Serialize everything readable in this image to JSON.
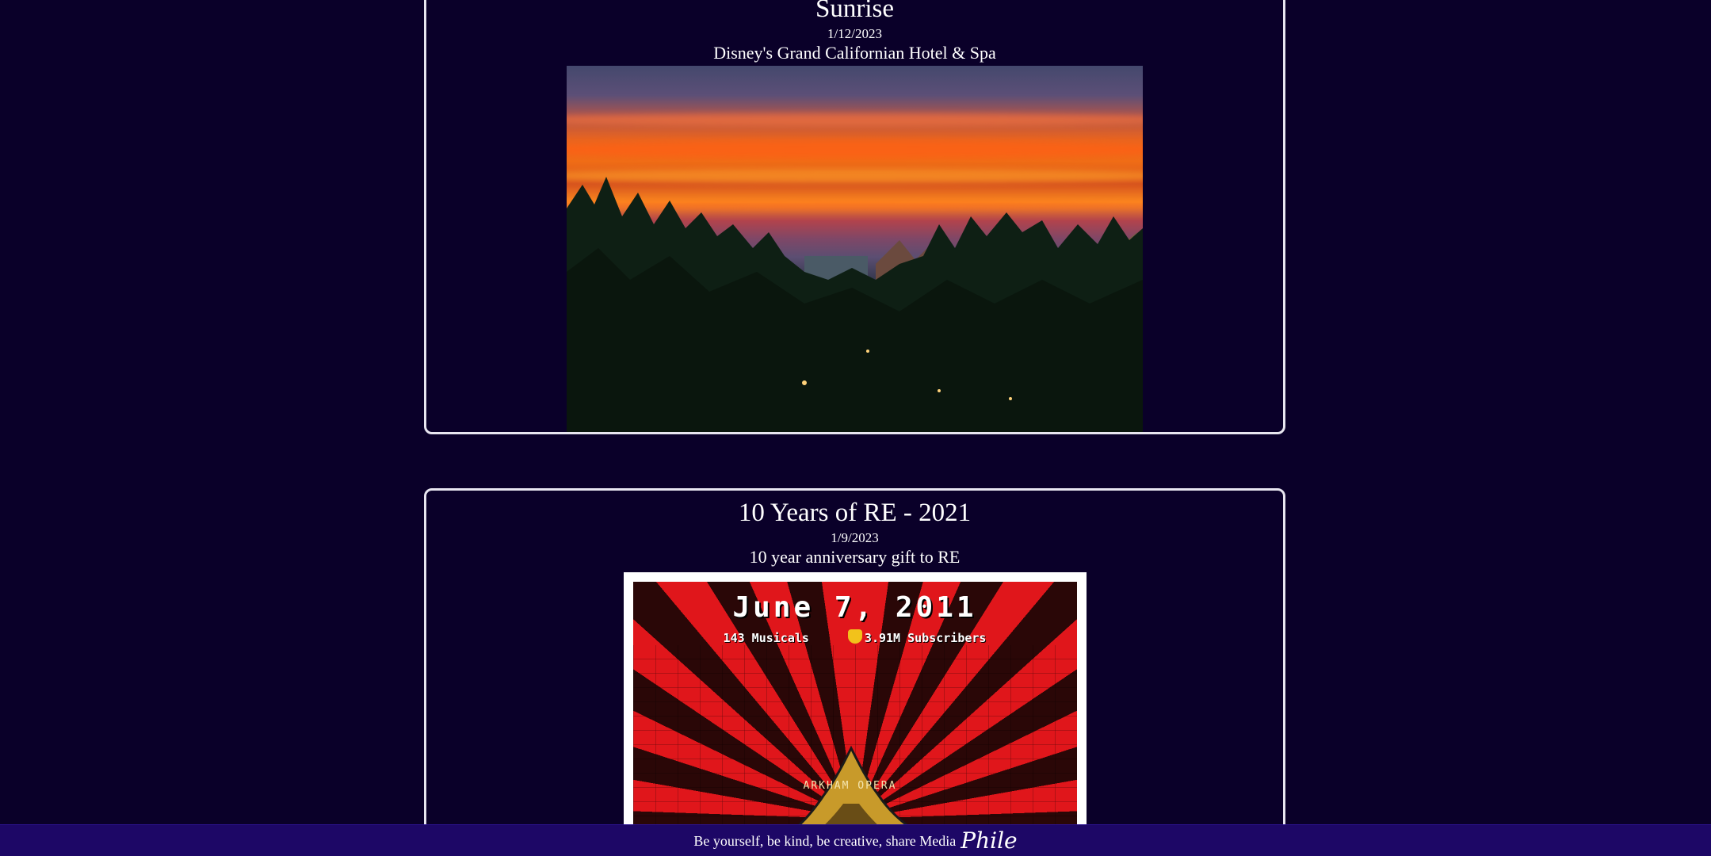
{
  "posts": [
    {
      "title": "Sunrise",
      "date": "1/12/2023",
      "description": "Disney's Grand Californian Hotel & Spa",
      "image": "sunrise-photo"
    },
    {
      "title": "10 Years of RE - 2021",
      "date": "1/9/2023",
      "description": "10 year anniversary gift to RE",
      "image": "anniversary-poster",
      "poster": {
        "headline": "June 7, 2011",
        "musicals": "143 Musicals",
        "subscribers": "3.91M Subscribers",
        "caption": "ARKHAM OPERA"
      }
    }
  ],
  "footer": {
    "text": "Be yourself, be kind, be creative, share Media",
    "brand": "Phile"
  },
  "colors": {
    "background": "#0a0029",
    "footer": "#1d0766",
    "border": "#e8e6f0"
  }
}
